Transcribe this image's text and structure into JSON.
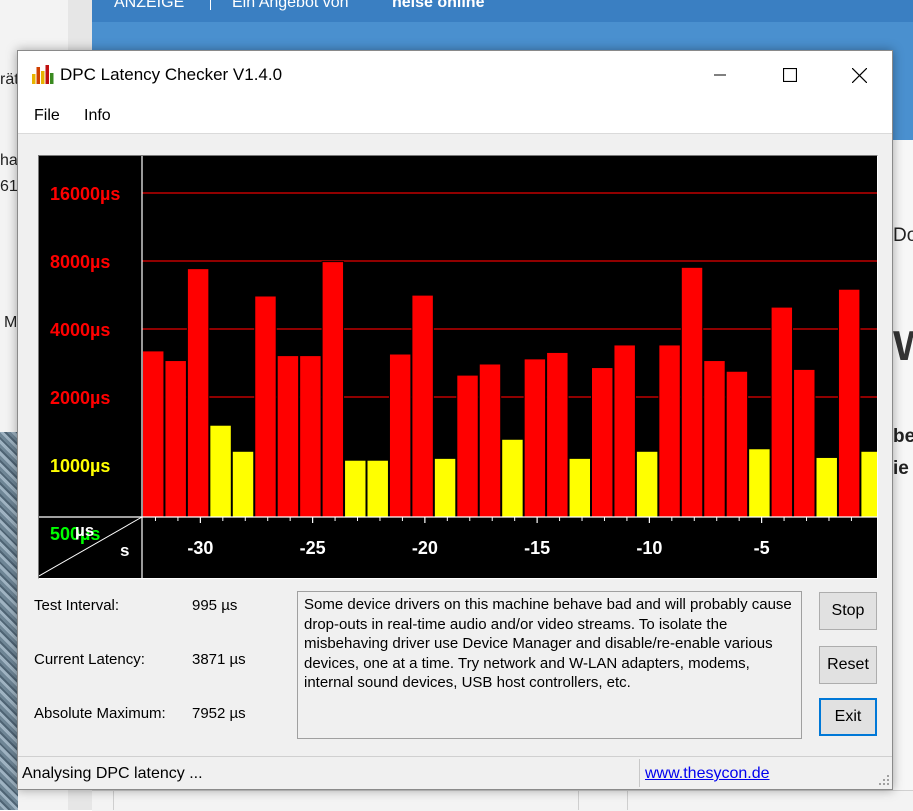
{
  "background": {
    "left_lines": [
      "rät",
      "hal",
      "61",
      "M"
    ],
    "header": [
      "ANZEIGE",
      "Ein Angebot von",
      "heise online"
    ],
    "right_lines": [
      "Do",
      "W",
      "be",
      "ie"
    ]
  },
  "window": {
    "title": "DPC Latency Checker V1.4.0",
    "menu": [
      "File",
      "Info"
    ]
  },
  "chart_data": {
    "type": "bar",
    "y_scale": "log",
    "y_unit": "µs",
    "y_ticks": [
      {
        "label": "16000µs",
        "value": 16000,
        "color": "#ff0000"
      },
      {
        "label": "8000µs",
        "value": 8000,
        "color": "#ff0000"
      },
      {
        "label": "4000µs",
        "value": 4000,
        "color": "#ff0000"
      },
      {
        "label": "2000µs",
        "value": 2000,
        "color": "#ff0000"
      },
      {
        "label": "1000µs",
        "value": 1000,
        "color": "#ffff00"
      },
      {
        "label": "500µs",
        "value": 500,
        "color": "#00ff00"
      }
    ],
    "gridlines": [
      16000,
      8000,
      4000,
      2000
    ],
    "x_ticks": [
      {
        "label": "-30",
        "value": -30
      },
      {
        "label": "-25",
        "value": -25
      },
      {
        "label": "-20",
        "value": -20
      },
      {
        "label": "-15",
        "value": -15
      },
      {
        "label": "-10",
        "value": -10
      },
      {
        "label": "-5",
        "value": -5
      }
    ],
    "axis_corner": {
      "y_unit": "µs",
      "x_unit": "s"
    },
    "x_start": -32.6,
    "x_step": 1,
    "values": [
      3200,
      2900,
      7400,
      1500,
      1150,
      5600,
      3050,
      3050,
      7950,
      1050,
      1050,
      3100,
      5650,
      1070,
      2500,
      2800,
      1300,
      2950,
      3150,
      1070,
      2700,
      3400,
      1150,
      3400,
      7500,
      2900,
      2600,
      1180,
      5000,
      2650,
      1080,
      6000,
      1150
    ],
    "colors": {
      "high": "#ff0000",
      "medium": "#ffff00",
      "low": "#00ff00",
      "grid": "#c00000"
    },
    "thresholds": {
      "high": 2000,
      "medium": 500
    }
  },
  "stats": {
    "test_interval_label": "Test Interval:",
    "test_interval_value": "995 µs",
    "current_latency_label": "Current Latency:",
    "current_latency_value": "3871 µs",
    "absolute_max_label": "Absolute Maximum:",
    "absolute_max_value": "7952 µs"
  },
  "message": "Some device drivers on this machine behave bad and will probably cause drop-outs in real-time audio and/or video streams. To isolate the misbehaving driver use Device Manager and disable/re-enable various devices, one at a time. Try network and W-LAN adapters, modems, internal sound devices, USB host controllers, etc.",
  "buttons": {
    "stop": "Stop",
    "reset": "Reset",
    "exit": "Exit"
  },
  "status": {
    "text": "Analysing DPC latency ...",
    "link": "www.thesycon.de"
  }
}
